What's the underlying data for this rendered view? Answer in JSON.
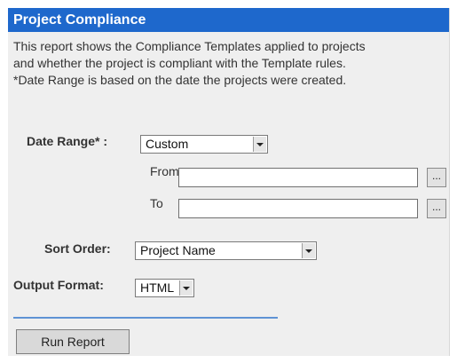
{
  "header": {
    "title": "Project Compliance"
  },
  "description": [
    "This report shows the Compliance Templates applied to projects",
    "and whether the project is compliant with the Template rules.",
    "*Date Range is based on the date the projects were created."
  ],
  "date_range": {
    "label": "Date Range* :",
    "selected": "Custom",
    "from_label": "From",
    "from_value": "",
    "from_button": "...",
    "to_label": "To",
    "to_value": "",
    "to_button": "..."
  },
  "sort_order": {
    "label": "Sort Order:",
    "selected": "Project Name"
  },
  "output_format": {
    "label": "Output Format:",
    "selected": "HTML"
  },
  "actions": {
    "run_label": "Run Report"
  }
}
